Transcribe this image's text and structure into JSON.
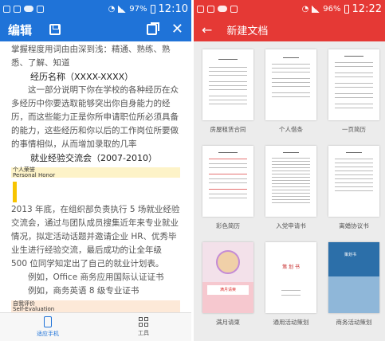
{
  "left": {
    "status_time": "12:10",
    "battery_pct": "97%",
    "toolbar": {
      "title": "编辑"
    },
    "doc": {
      "lines": [
        "掌握程度用词由由深到浅：精通、熟练、熟悉、了解、知道",
        "经历名称（XXXX-XXXX）",
        "这一部分说明下你在学校的各种经历在众多经历中你要选取能够突出你自身能力的经历，而这些能力正是你所申请职位所必须具备的能力，这些经历和你以后的工作岗位所要做的事情相似，从而增加录取的几率",
        "就业经验交流会（2007-2010）",
        "2013 年底，在组织部负责执行 5 场就业经验交流会，通过与团队成员搜集近年来专业就业情况，拟定活动话题并邀请企业 HR、优秀毕业生进行经验交流，最后成功的让全年级 500 位同学知定出了自己的就业计划表。",
        "例如，Office 商务应用国际认证证书",
        "例如，商务英语 8 级专业证书"
      ],
      "honor_label_cn": "个人荣誉",
      "honor_label_en": "Personal Honor",
      "self_eval_cn": "自我评价",
      "self_eval_en": "Self-Evaluation"
    },
    "bottom_tabs": [
      {
        "label": "适应手机"
      },
      {
        "label": "工具"
      }
    ]
  },
  "right": {
    "status_time": "12:22",
    "battery_pct": "96%",
    "toolbar": {
      "title": "新建文档"
    },
    "templates": [
      {
        "label": "房屋租赁合同"
      },
      {
        "label": "个人借条"
      },
      {
        "label": "一页简历"
      },
      {
        "label": "彩色简历"
      },
      {
        "label": "入党申请书"
      },
      {
        "label": "离婚协议书"
      },
      {
        "label": "满月请柬"
      },
      {
        "label": "通用活动策划"
      },
      {
        "label": "商务活动策划"
      }
    ],
    "thumb_texts": {
      "invite": "满月请柬",
      "plan_title": "策 划 书",
      "biz_title": "策划书"
    }
  },
  "colors": {
    "left_accent": "#1f73d8",
    "right_accent": "#e53935"
  }
}
